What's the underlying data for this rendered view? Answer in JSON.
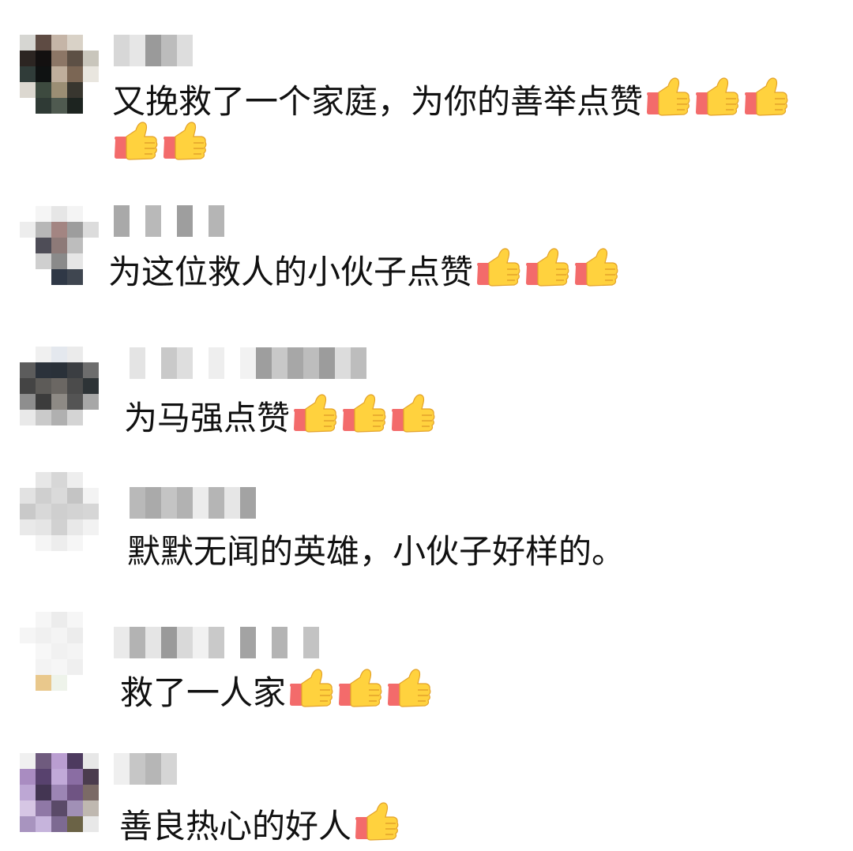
{
  "comments": [
    {
      "text": "又挽救了一个家庭，为你的善举点赞",
      "thumbs_line1": 3,
      "thumbs_line2": 2
    },
    {
      "text": "为这位救人的小伙子点赞",
      "thumbs": 3
    },
    {
      "text": "为马强点赞",
      "thumbs": 3
    },
    {
      "text": "默默无闻的英雄，小伙子好样的。",
      "thumbs": 0
    },
    {
      "text": "救了一人家",
      "thumbs": 3
    },
    {
      "text": "善良热心的好人",
      "thumbs": 1
    }
  ],
  "icons": {
    "thumb": "thumbs-up-icon",
    "avatar": "avatar",
    "name": "blurred-username"
  },
  "colors": {
    "thumb_hand": "#FFD23E",
    "thumb_cuff": "#F36B6B",
    "thumb_outline": "#E3A22A",
    "text": "#111111",
    "background": "#FFFFFF"
  }
}
